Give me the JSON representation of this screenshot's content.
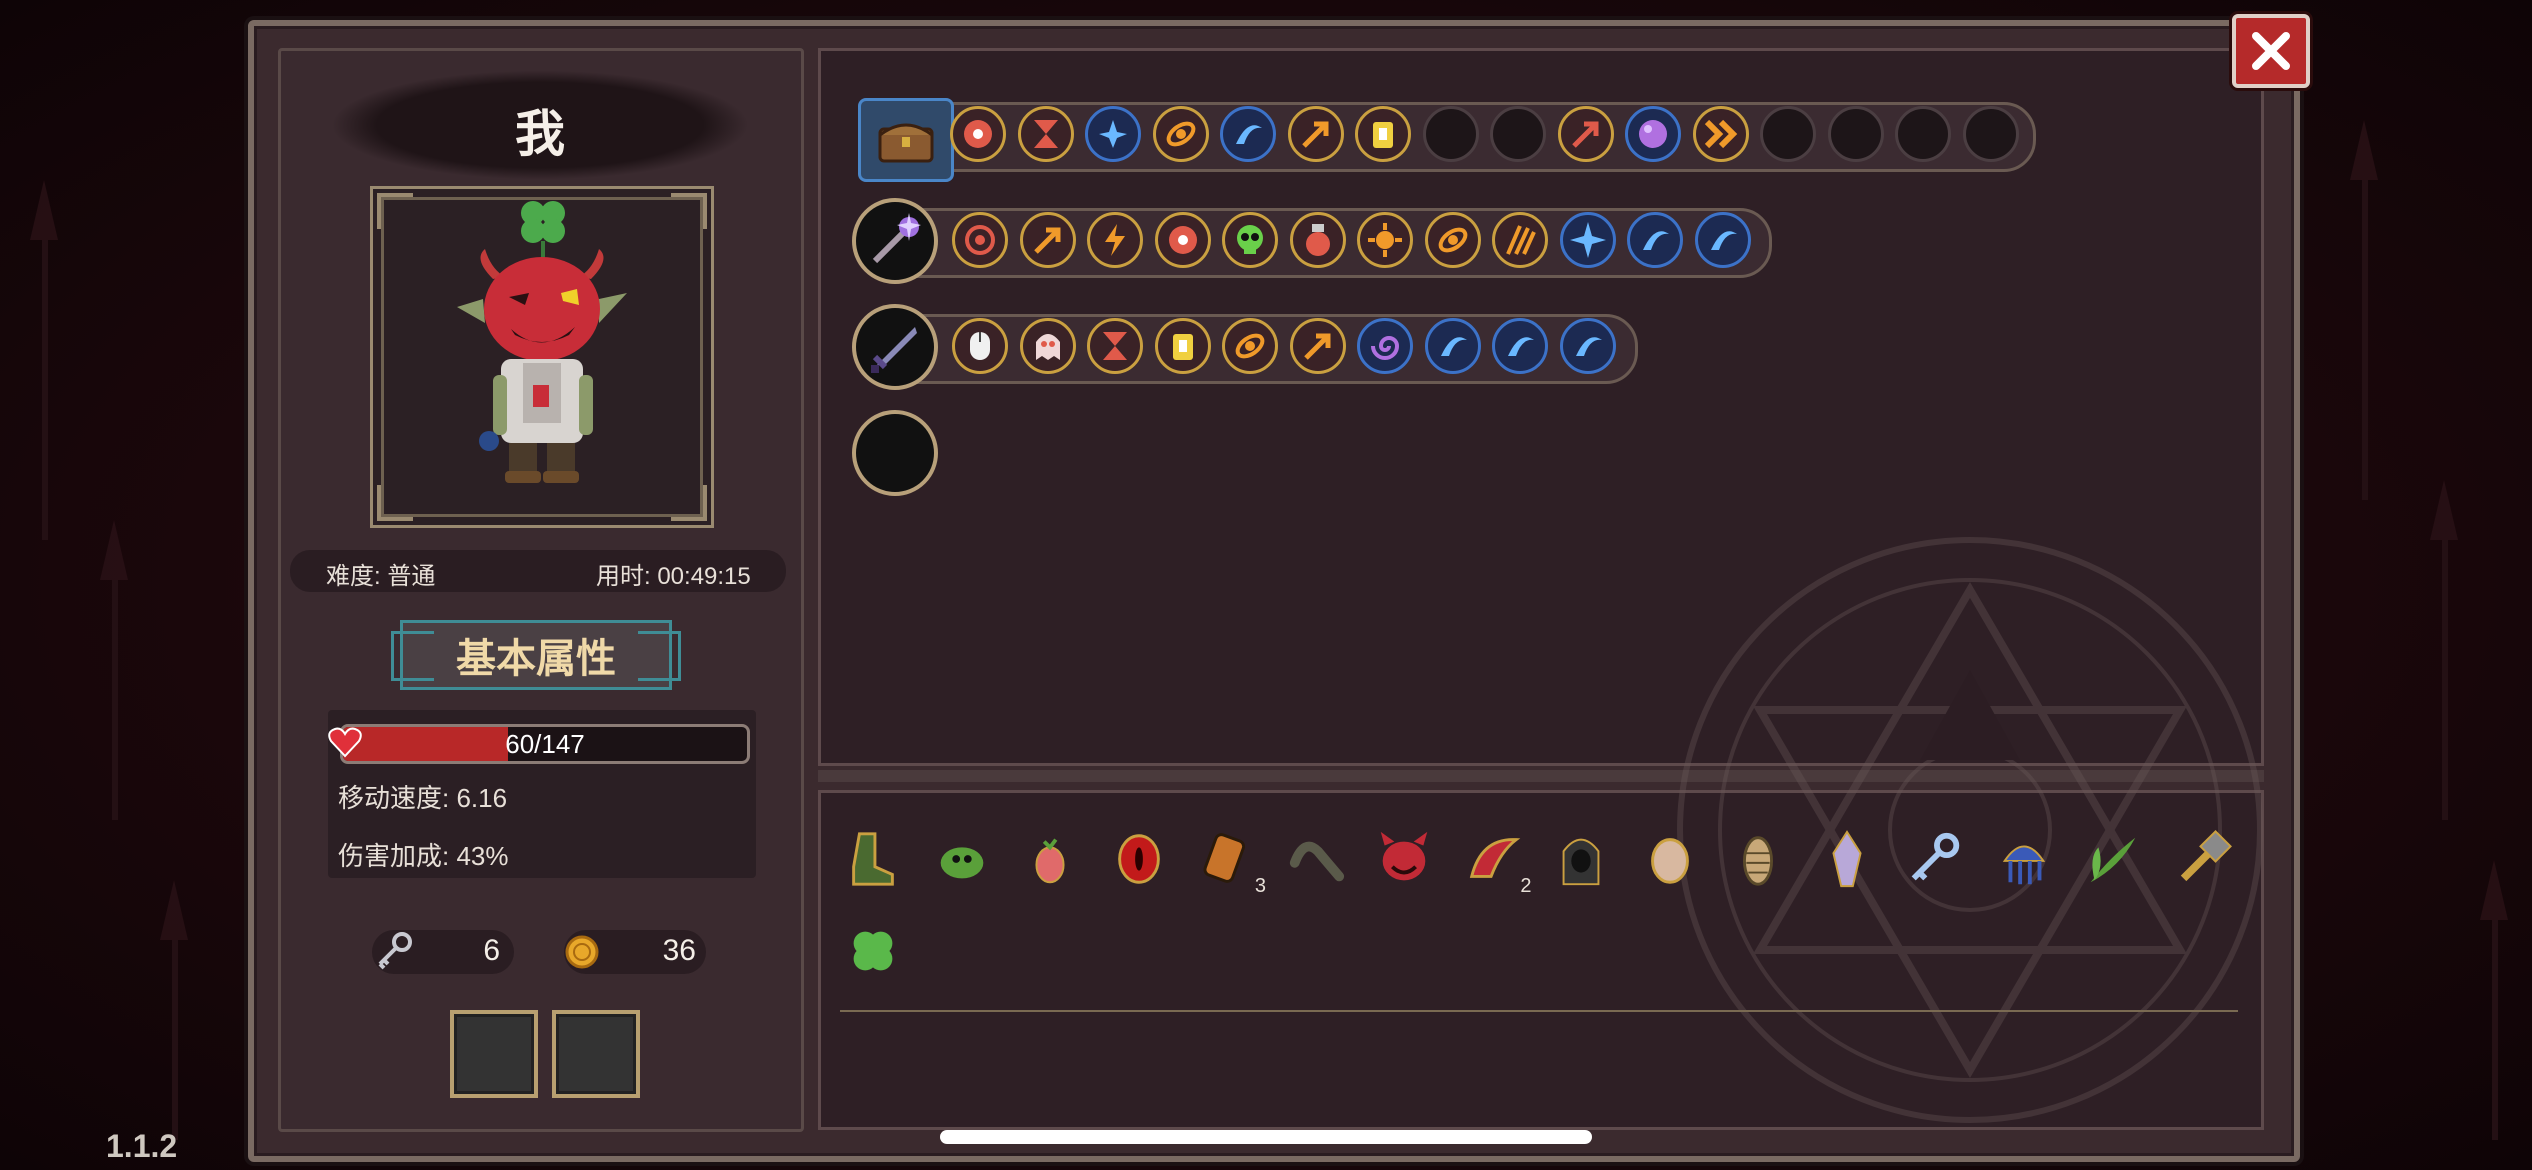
{
  "player": {
    "name": "我"
  },
  "info": {
    "difficulty": "难度: 普通",
    "time": "用时: 00:49:15"
  },
  "tab": {
    "label": "基本属性"
  },
  "stats": {
    "hp_text": "60/147",
    "hp_fraction": 0.408,
    "move_speed": "移动速度: 6.16",
    "damage_bonus": "伤害加成: 43%"
  },
  "resources": {
    "keys": "6",
    "coins": "36"
  },
  "version": "1.1.2",
  "colors": {
    "accent_gold": "#caa040",
    "accent_blue": "#3c72c8",
    "hp_red": "#b82828",
    "close_red": "#b52a2a"
  },
  "rows": [
    {
      "head": "chest-icon",
      "slots": [
        "flower-red",
        "hourglass-red",
        "splash-blue",
        "orbit-orange",
        "wave-blue",
        "arrow-up-right-orange",
        "lantern-yellow",
        "empty",
        "empty",
        "arrow-up-red",
        "purple-gem",
        "double-chevron-orange",
        "empty",
        "empty",
        "empty",
        "empty"
      ]
    },
    {
      "head": "staff-icon",
      "slots": [
        "target-red",
        "arrows-up-orange",
        "lightning-orange",
        "flower-red",
        "skull-green",
        "potion-red",
        "sun-orange",
        "orbit-orange",
        "claws-orange",
        "sparkle-blue",
        "crescent-blue",
        "wave-blue"
      ]
    },
    {
      "head": "sword-icon",
      "slots": [
        "mouse-white",
        "ghost-red",
        "hourglass-red",
        "lantern-yellow",
        "orbit-orange",
        "arrow-up-right-orange",
        "vortex-purple",
        "wave-blue",
        "wave-blue",
        "wave-blue"
      ]
    },
    {
      "head": "empty-weapon",
      "slots": []
    }
  ],
  "inventory": [
    {
      "icon": "boot-icon",
      "count": ""
    },
    {
      "icon": "green-blob-icon",
      "count": ""
    },
    {
      "icon": "radish-icon",
      "count": ""
    },
    {
      "icon": "red-eye-icon",
      "count": ""
    },
    {
      "icon": "scroll-icon",
      "count": "3"
    },
    {
      "icon": "worm-icon",
      "count": ""
    },
    {
      "icon": "demon-mask-icon",
      "count": ""
    },
    {
      "icon": "red-horn-icon",
      "count": "2"
    },
    {
      "icon": "hood-icon",
      "count": ""
    },
    {
      "icon": "egg-icon",
      "count": ""
    },
    {
      "icon": "cocoon-icon",
      "count": ""
    },
    {
      "icon": "crystal-icon",
      "count": ""
    },
    {
      "icon": "key-icon",
      "count": ""
    },
    {
      "icon": "jellyfish-icon",
      "count": ""
    },
    {
      "icon": "sprout-icon",
      "count": ""
    },
    {
      "icon": "hammer-icon",
      "count": ""
    },
    {
      "icon": "clover-icon",
      "count": ""
    }
  ]
}
